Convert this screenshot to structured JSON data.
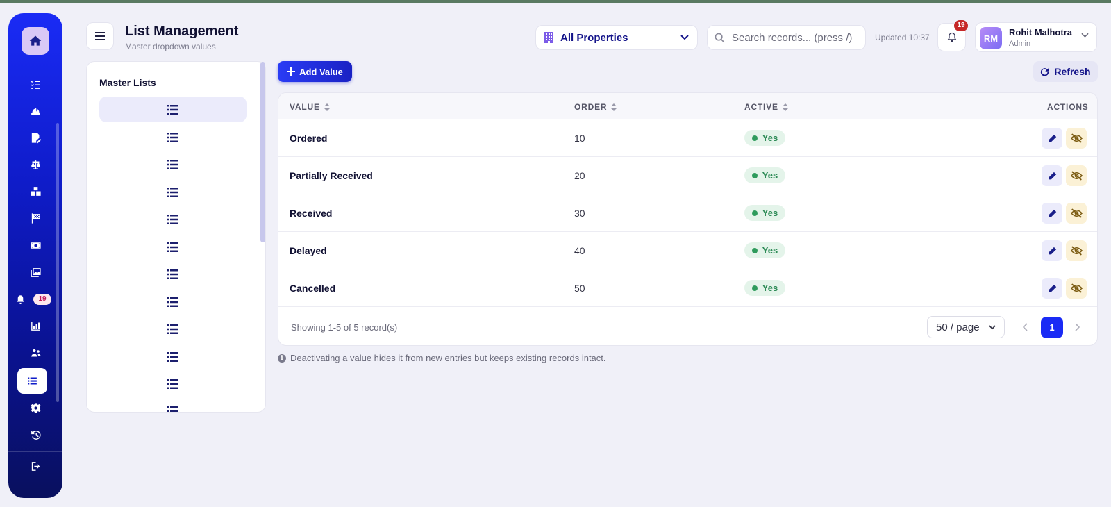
{
  "header": {
    "title": "List Management",
    "subtitle": "Master dropdown values",
    "property_select": "All Properties",
    "search_placeholder": "Search records... (press /)",
    "updated": "Updated 10:37",
    "notification_count": "19",
    "user": {
      "initials": "RM",
      "name": "Rohit Malhotra",
      "role": "Admin"
    }
  },
  "sidebar": {
    "notification_badge": "19",
    "items": [
      "home-icon",
      "checklist-icon",
      "hardhat-icon",
      "edit-document-icon",
      "scale-icon",
      "boxes-icon",
      "flag-icon",
      "money-icon",
      "gallery-icon",
      "bell-icon",
      "chart-icon",
      "users-icon",
      "list-icon",
      "gear-icon",
      "history-icon",
      "logout-icon"
    ],
    "active": "list-icon"
  },
  "master_lists": {
    "title": "Master Lists",
    "item_count_visible": 12
  },
  "toolbar": {
    "add_label": "Add Value",
    "refresh_label": "Refresh"
  },
  "table": {
    "columns": {
      "value": "VALUE",
      "order": "ORDER",
      "active": "ACTIVE",
      "actions": "ACTIONS"
    },
    "rows": [
      {
        "value": "Ordered",
        "order": "10",
        "active": "Yes"
      },
      {
        "value": "Partially Received",
        "order": "20",
        "active": "Yes"
      },
      {
        "value": "Received",
        "order": "30",
        "active": "Yes"
      },
      {
        "value": "Delayed",
        "order": "40",
        "active": "Yes"
      },
      {
        "value": "Cancelled",
        "order": "50",
        "active": "Yes"
      }
    ],
    "footer": "Showing 1-5 of 5 record(s)",
    "page_size": "50 / page",
    "current_page": "1"
  },
  "note": "Deactivating a value hides it from new entries but keeps existing records intact.",
  "colors": {
    "primary": "#1a2bf5",
    "sidebar_dark": "#09105e",
    "active_green": "#2e8b57",
    "badge_red": "#c62828"
  }
}
